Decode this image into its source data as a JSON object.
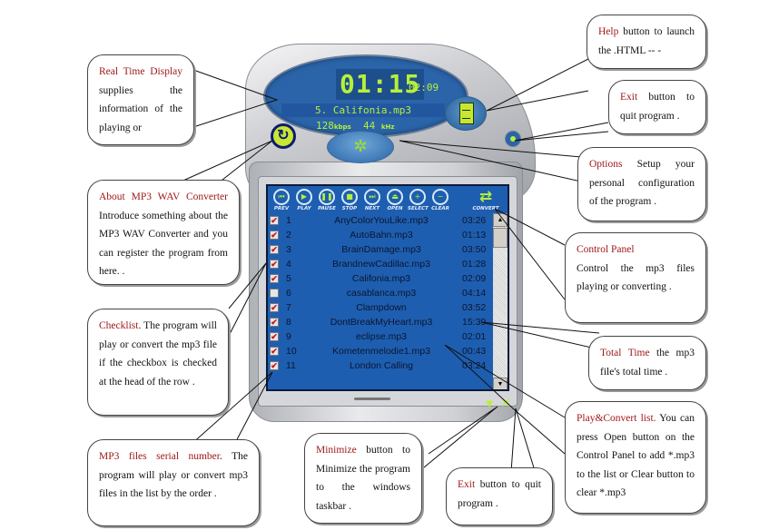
{
  "player": {
    "elapsed_time": "01:15",
    "total_time": "02:09",
    "current_song": "5. Califonia.mp3",
    "bitrate": "128",
    "bitrate_unit": "kbps",
    "sample_rate": "44",
    "sample_rate_unit": "kHz",
    "controls": [
      {
        "label": "PREV",
        "icon": "prev-icon",
        "glyph": "⏮"
      },
      {
        "label": "PLAY",
        "icon": "play-icon",
        "glyph": "▶"
      },
      {
        "label": "PAUSE",
        "icon": "pause-icon",
        "glyph": "❚❚"
      },
      {
        "label": "STOP",
        "icon": "stop-icon",
        "glyph": "■"
      },
      {
        "label": "NEXT",
        "icon": "next-icon",
        "glyph": "⏭"
      },
      {
        "label": "OPEN",
        "icon": "eject-icon",
        "glyph": "⏏"
      },
      {
        "label": "SELECT",
        "icon": "plus-icon",
        "glyph": "+"
      },
      {
        "label": "CLEAR",
        "icon": "minus-icon",
        "glyph": "−"
      }
    ],
    "convert_label": "CONVERT",
    "convert_glyph": "⇄",
    "about_glyph": "↻",
    "options_glyph": "✲",
    "minimize_glyph": "▼",
    "exit_glyph": "✕",
    "scroll_up_glyph": "▲",
    "scroll_down_glyph": "▼",
    "check_glyph": "✔",
    "playlist": [
      {
        "num": "1",
        "name": "AnyColorYouLike.mp3",
        "time": "03:26",
        "checked": true
      },
      {
        "num": "2",
        "name": "AutoBahn.mp3",
        "time": "01:13",
        "checked": true
      },
      {
        "num": "3",
        "name": "BrainDamage.mp3",
        "time": "03:50",
        "checked": true
      },
      {
        "num": "4",
        "name": "BrandnewCadillac.mp3",
        "time": "01:28",
        "checked": true
      },
      {
        "num": "5",
        "name": "Califonia.mp3",
        "time": "02:09",
        "checked": true
      },
      {
        "num": "6",
        "name": "casablanca.mp3",
        "time": "04:14",
        "checked": false
      },
      {
        "num": "7",
        "name": "Clampdown",
        "time": "03:52",
        "checked": true
      },
      {
        "num": "8",
        "name": "DontBreakMyHeart.mp3",
        "time": "15:39",
        "checked": true
      },
      {
        "num": "9",
        "name": "eclipse.mp3",
        "time": "02:01",
        "checked": true
      },
      {
        "num": "10",
        "name": "Kometenmelodie1.mp3",
        "time": "00:43",
        "checked": true
      },
      {
        "num": "11",
        "name": "London Calling",
        "time": "03:24",
        "checked": true
      }
    ]
  },
  "callouts": {
    "realtime": {
      "title": "Real Time Display",
      "text": " supplies the information of the playing or"
    },
    "about": {
      "title": "About MP3 WAV Converter",
      "text": " Introduce something about the MP3 WAV Converter and you can register the program from here. ."
    },
    "checklist": {
      "title": "Checklist",
      "text": ". The program will play or convert the mp3 file if the checkbox is checked at the head of the row ."
    },
    "serial": {
      "title": "MP3 files serial number",
      "text": ". The program will play or convert mp3 files in the list by the order ."
    },
    "minimize": {
      "title": "Minimize",
      "text": " button to Minimize the program to the windows taskbar ."
    },
    "exit_bottom": {
      "title": "Exit",
      "text": " button to quit program ."
    },
    "help": {
      "title": "Help",
      "text": " button to launch the .HTML -- -"
    },
    "exit_top": {
      "title": "Exit",
      "text": " button to quit program ."
    },
    "options": {
      "title": "Options",
      "text": " Setup your personal configuration of the program ."
    },
    "control_panel": {
      "title": "Control Panel",
      "text": "Control the mp3 files playing or converting ."
    },
    "total_time": {
      "title": "Total Time",
      "text": " the mp3 file's total time ."
    },
    "playlist": {
      "title": "Play&Convert list.",
      "text": " You can press Open button on the Control Panel to add *.mp3 to the list or Clear button to clear *.mp3"
    }
  }
}
